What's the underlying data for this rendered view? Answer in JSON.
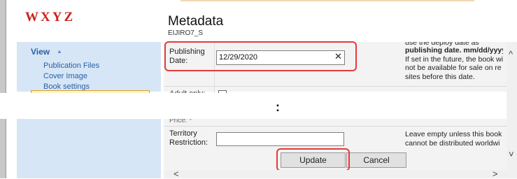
{
  "brand": {
    "logo_text": "WXYZ"
  },
  "page": {
    "title": "Metadata",
    "subtitle": "EIJIRO7_S",
    "ellipsis": ":"
  },
  "sidebar": {
    "view_label": "View",
    "links": [
      "Publication Files",
      "Cover Image",
      "Book settings"
    ]
  },
  "form": {
    "publishing_date": {
      "label_line1": "Publishing",
      "label_line2": "Date:",
      "value": "12/29/2020",
      "help": [
        "use the deploy date as",
        "publishing date. mm/dd/yyyy",
        "If set in the future, the book wi",
        "not be available for sale on re",
        "sites before this date."
      ]
    },
    "adult_label": "Adult only:",
    "price_label": "Price: *",
    "territory": {
      "label_line1": "Territory",
      "label_line2": "Restriction:",
      "value": "",
      "help": [
        "Leave empty unless this book",
        "cannot be distributed worldwi"
      ]
    }
  },
  "buttons": {
    "update": "Update",
    "cancel": "Cancel"
  },
  "colors": {
    "logo": "#c9221b",
    "link": "#2a5fa5",
    "highlight_box": "#e53a3a",
    "sidebar_bg": "#d7e6f6"
  }
}
